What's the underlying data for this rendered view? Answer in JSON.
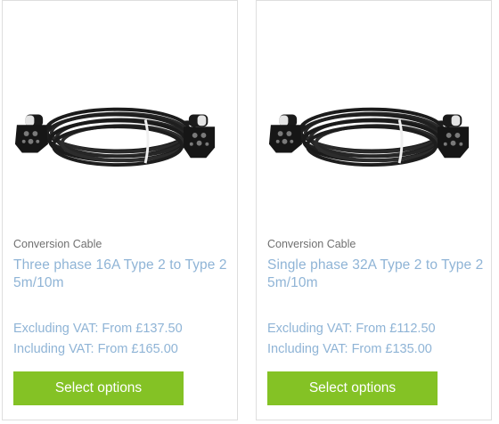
{
  "products": [
    {
      "category": "Conversion Cable",
      "title": "Three phase 16A Type 2 to Type 2 5m/10m",
      "price_ex_vat": "Excluding VAT: From £137.50",
      "price_inc_vat": "Including VAT: From £165.00",
      "button_label": "Select options"
    },
    {
      "category": "Conversion Cable",
      "title": "Single phase 32A Type 2 to Type 2 5m/10m",
      "price_ex_vat": "Excluding VAT: From £112.50",
      "price_inc_vat": "Including VAT: From £135.00",
      "button_label": "Select options"
    }
  ],
  "colors": {
    "link": "#8fb4d6",
    "button": "#84c225",
    "category_text": "#707070"
  },
  "icons": {
    "product_image": "ev-charging-cable-image"
  }
}
